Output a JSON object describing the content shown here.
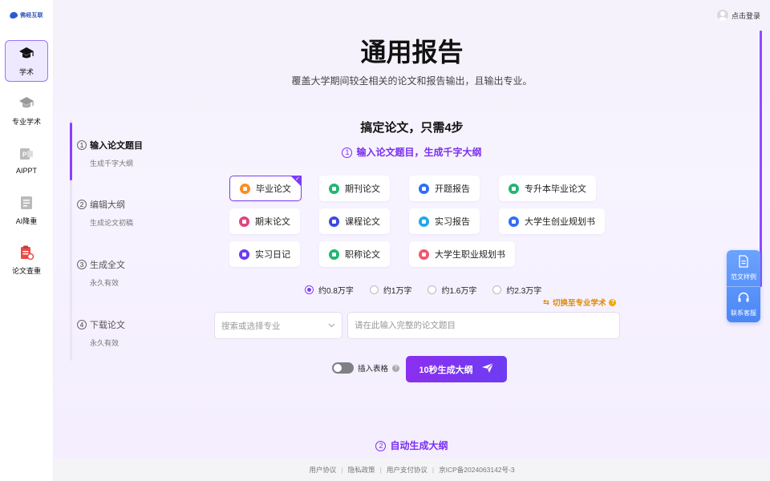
{
  "brand": {
    "logo_text": "佛经互联"
  },
  "sidebar": {
    "items": [
      {
        "label": "学术",
        "active": true
      },
      {
        "label": "专业学术"
      },
      {
        "label": "AIPPT"
      },
      {
        "label": "AI降重"
      },
      {
        "label": "论文查重"
      }
    ]
  },
  "header": {
    "login_label": "点击登录"
  },
  "hero": {
    "title": "通用报告",
    "subtitle": "覆盖大学期间较全相关的论文和报告输出，且输出专业。"
  },
  "steps": [
    {
      "num": "1",
      "title": "输入论文题目",
      "sub": "生成千字大纲",
      "active": true
    },
    {
      "num": "2",
      "title": "编辑大纲",
      "sub": "生成论文初稿"
    },
    {
      "num": "3",
      "title": "生成全文",
      "sub": "永久有效"
    },
    {
      "num": "4",
      "title": "下载论文",
      "sub": "永久有效"
    }
  ],
  "section": {
    "heading": "搞定论文，只需4步",
    "step_num": "1",
    "step_label": "输入论文题目，生成千字大纲"
  },
  "paper_types": [
    {
      "label": "毕业论文",
      "color": "#ff8a1e",
      "selected": true
    },
    {
      "label": "期刊论文",
      "color": "#22b573"
    },
    {
      "label": "开题报告",
      "color": "#2f6df6"
    },
    {
      "label": "专升本毕业论文",
      "color": "#22b573"
    },
    {
      "label": "期末论文",
      "color": "#e0457b"
    },
    {
      "label": "课程论文",
      "color": "#3b4ae0"
    },
    {
      "label": "实习报告",
      "color": "#23a8e8"
    },
    {
      "label": "大学生创业规划书",
      "color": "#2f6df6"
    },
    {
      "label": "实习日记",
      "color": "#6a3df0"
    },
    {
      "label": "职称论文",
      "color": "#22b573"
    },
    {
      "label": "大学生职业规划书",
      "color": "#f0576a"
    }
  ],
  "word_counts": [
    {
      "label": "约0.8万字",
      "checked": true
    },
    {
      "label": "约1万字"
    },
    {
      "label": "约1.6万字"
    },
    {
      "label": "约2.3万字"
    }
  ],
  "switch_link": "切换至专业学术",
  "major_select": {
    "placeholder": "搜索或选择专业"
  },
  "topic_input": {
    "placeholder": "请在此输入完整的论文题目"
  },
  "insert_table": {
    "label": "插入表格"
  },
  "generate_button": {
    "label": "10秒生成大纲"
  },
  "next_step": {
    "num": "2",
    "label": "自动生成大纲"
  },
  "float_panel": {
    "sample_label": "范文样例",
    "service_label": "联系客服"
  },
  "footer": {
    "links": [
      "用户协议",
      "隐私政策",
      "用户支付协议",
      "京ICP备2024063142号-3"
    ]
  },
  "colors": {
    "accent": "#7b3df5",
    "float_blue": "#4b86f5",
    "warning": "#e08a00"
  }
}
